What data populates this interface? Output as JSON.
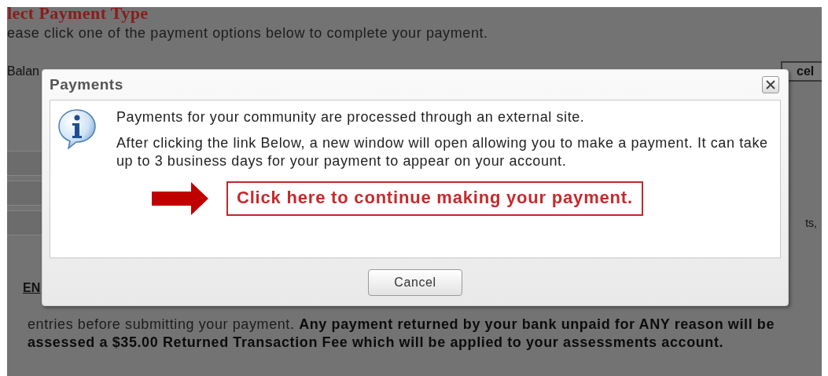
{
  "background_page": {
    "heading": "lect Payment Type",
    "instruction": "ease click one of the payment options below to complete your payment.",
    "balance_label": "Balan",
    "cancel_button": "cel",
    "side_note": "ts,",
    "section_heading": "EN",
    "note": "entries before submitting your payment. **Any payment returned by your bank unpaid for ANY reason will be assessed a $35.00 Returned Transaction Fee which will be applied to your assessments account.**"
  },
  "dialog": {
    "title": "Payments",
    "messages": [
      "Payments for your community are processed through an external site.",
      "After clicking the link Below, a new window will open allowing you to make a payment. It can take up to 3 business days for your payment to appear on your account."
    ],
    "link": "Click here to continue making your payment.",
    "button": "Cancel"
  }
}
